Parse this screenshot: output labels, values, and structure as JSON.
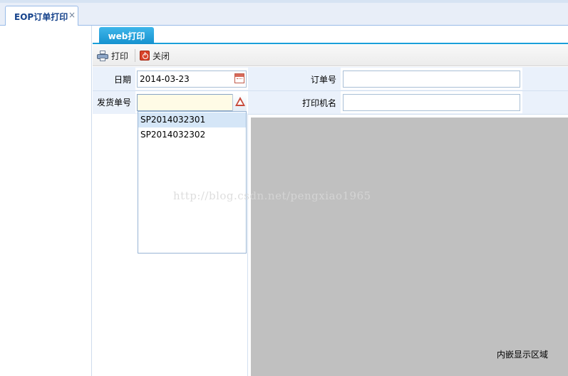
{
  "outer_tab": {
    "label": "EOP订单打印",
    "close": "×"
  },
  "inner_tab": {
    "label": "web打印"
  },
  "toolbar": {
    "print_label": "打印",
    "close_label": "关闭"
  },
  "form": {
    "date_label": "日期",
    "date_value": "2014-03-23",
    "order_no_label": "订单号",
    "order_no_value": "",
    "ship_no_label": "发货单号",
    "ship_no_value": "",
    "printer_label": "打印机名",
    "printer_value": ""
  },
  "dropdown": {
    "options": [
      "SP2014032301",
      "SP2014032302"
    ],
    "highlighted_index": 0
  },
  "embed": {
    "label": "内嵌显示区域"
  },
  "watermark": "http://blog.csdn.net/pengxiao1965"
}
